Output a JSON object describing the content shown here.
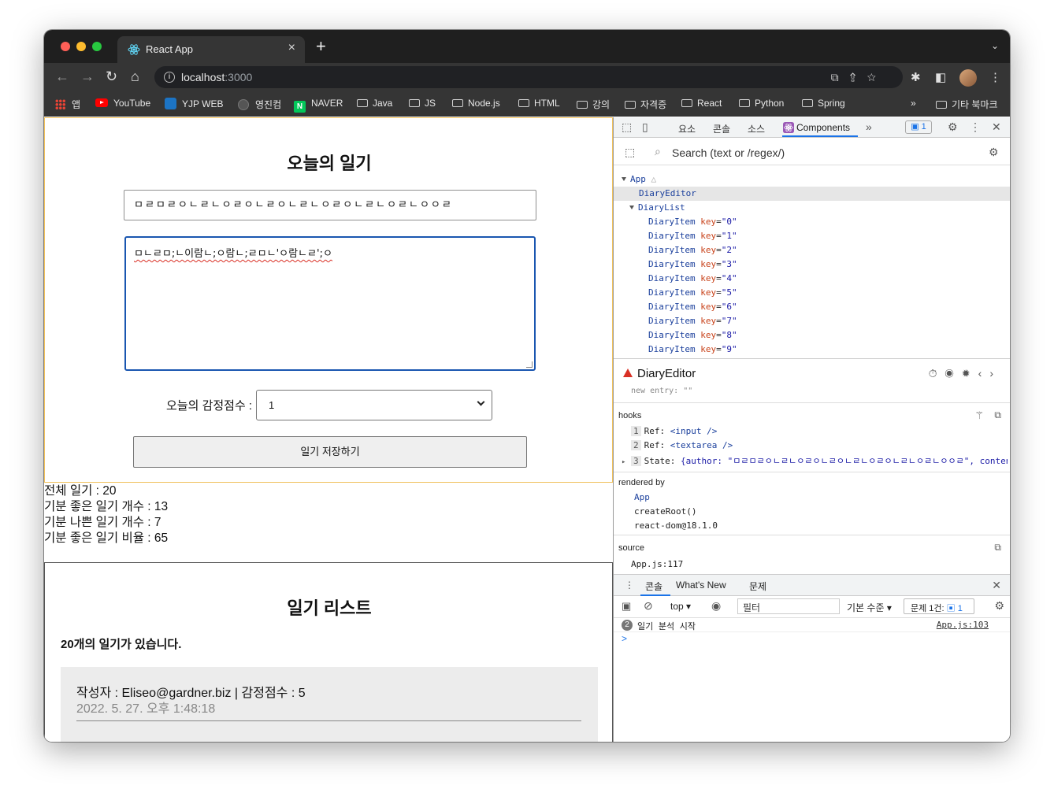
{
  "browser": {
    "tab_title": "React App",
    "url_host": "localhost",
    "url_port": ":3000"
  },
  "bookmarks": [
    {
      "label": "앱",
      "icon": "apps-icon"
    },
    {
      "label": "YouTube",
      "icon": "youtube-icon"
    },
    {
      "label": "YJP WEB",
      "icon": "yjp-icon"
    },
    {
      "label": "영진컴",
      "icon": "globe-icon"
    },
    {
      "label": "NAVER",
      "icon": "naver-icon"
    },
    {
      "label": "Java",
      "icon": "folder-icon"
    },
    {
      "label": "JS",
      "icon": "folder-icon"
    },
    {
      "label": "Node.js",
      "icon": "folder-icon"
    },
    {
      "label": "HTML",
      "icon": "folder-icon"
    },
    {
      "label": "강의",
      "icon": "folder-icon"
    },
    {
      "label": "자격증",
      "icon": "folder-icon"
    },
    {
      "label": "React",
      "icon": "folder-icon"
    },
    {
      "label": "Python",
      "icon": "folder-icon"
    },
    {
      "label": "Spring",
      "icon": "folder-icon"
    },
    {
      "label": "기타 북마크",
      "icon": "folder-icon"
    }
  ],
  "editor": {
    "title": "오늘의 일기",
    "author_value": "ㅁㄹㅁㄹㅇㄴㄹㄴㅇㄹㅇㄴㄹㅇㄴㄹㄴㅇㄹㅇㄴㄹㄴㅇㄹㄴㅇㅇㄹ",
    "content_value": "ㅁㄴㄹㅁ;ㄴ이람ㄴ;ㅇ람ㄴ;ㄹㅁㄴ'ㅇ람ㄴㄹ';ㅇ",
    "emotion_label": "오늘의 감정점수 :",
    "emotion_value": "1",
    "save_label": "일기 저장하기"
  },
  "stats": {
    "total": "전체 일기 : 20",
    "good": "기분 좋은 일기 개수 : 13",
    "bad": "기분 나쁜 일기 개수 : 7",
    "ratio": "기분 좋은 일기 비율 : 65"
  },
  "list": {
    "title": "일기 리스트",
    "count_text": "20개의 일기가 있습니다.",
    "items": [
      {
        "info": "작성자 : Eliseo@gardner.biz | 감정점수 : 5",
        "date": "2022. 5. 27. 오후 1:48:18"
      }
    ]
  },
  "devtools": {
    "tabs": [
      "요소",
      "콘솔",
      "소스",
      "Components"
    ],
    "issues_badge": "1",
    "search_placeholder": "Search (text or /regex/)",
    "tree": {
      "app": "App",
      "editor": "DiaryEditor",
      "list": "DiaryList",
      "item_name": "DiaryItem",
      "keys": [
        "\"0\"",
        "\"1\"",
        "\"2\"",
        "\"3\"",
        "\"4\"",
        "\"5\"",
        "\"6\"",
        "\"7\"",
        "\"8\"",
        "\"9\""
      ]
    },
    "selected": "DiaryEditor",
    "cutoff_text": "new entry: \"\"",
    "hooks_title": "hooks",
    "hooks": [
      {
        "idx": "1",
        "name": "Ref:",
        "value": "<input />"
      },
      {
        "idx": "2",
        "name": "Ref:",
        "value": "<textarea />"
      },
      {
        "idx": "3",
        "name": "State:",
        "value": "{author: \"ㅁㄹㅁㄹㅇㄴㄹㄴㅇㄹㅇㄴㄹㅇㄴㄹㄴㅇㄹㅇㄴㄹㄴㅇㄹㄴㅇㅇㄹ\", conten…"
      }
    ],
    "rendered_by_title": "rendered by",
    "rendered_by": [
      "App",
      "createRoot()",
      "react-dom@18.1.0"
    ],
    "source_title": "source",
    "source": "App.js:117",
    "console_tabs": [
      "콘솔",
      "What's New",
      "문제"
    ],
    "context": "top",
    "filter_placeholder": "필터",
    "level": "기본 수준",
    "issues_text": "문제 1건:",
    "issues_count": "1",
    "message_count": "2",
    "message": "일기 분석 시작",
    "message_source": "App.js:103",
    "prompt": ">"
  }
}
